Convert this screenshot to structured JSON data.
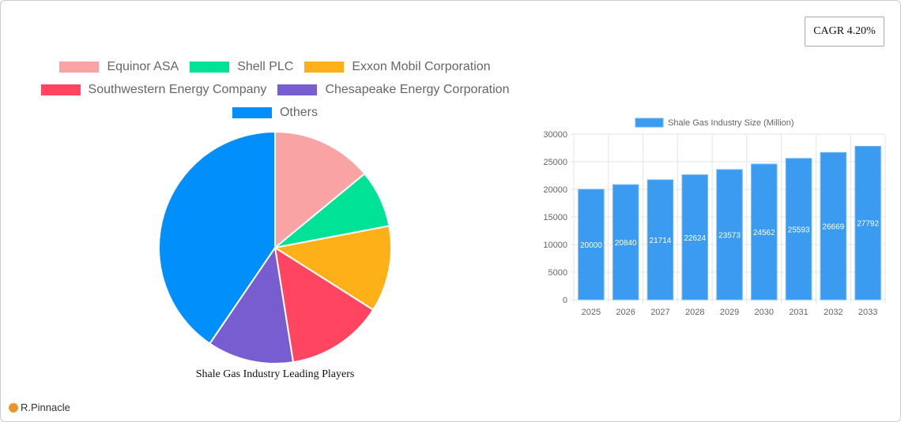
{
  "cagr_label": "CAGR 4.20%",
  "brand": "R.Pinnacle",
  "chart_data": [
    {
      "type": "pie",
      "title": "Shale Gas Industry Leading Players",
      "legend_position": "top",
      "categories": [
        "Equinor ASA",
        "Shell PLC",
        "Exxon Mobil Corporation",
        "Southwestern Energy Company",
        "Chesapeake Energy Corporation",
        "Others"
      ],
      "values": [
        14,
        8,
        12,
        13.5,
        12,
        40.5
      ],
      "colors": [
        "#f9a3a4",
        "#00e396",
        "#feb019",
        "#ff4560",
        "#775dd0",
        "#008ffb"
      ]
    },
    {
      "type": "bar",
      "series": [
        {
          "name": "Shale Gas Industry Size (Million)",
          "values": [
            20000,
            20840,
            21714,
            22624,
            23573,
            24562,
            25593,
            26669,
            27792
          ]
        }
      ],
      "categories": [
        "2025",
        "2026",
        "2027",
        "2028",
        "2029",
        "2030",
        "2031",
        "2032",
        "2033"
      ],
      "ylim": [
        0,
        30000
      ],
      "yticks": [
        "0",
        "5000",
        "10000",
        "15000",
        "20000",
        "25000",
        "30000"
      ],
      "grid": true,
      "legend_position": "top",
      "color": "#3a9bf0"
    }
  ]
}
